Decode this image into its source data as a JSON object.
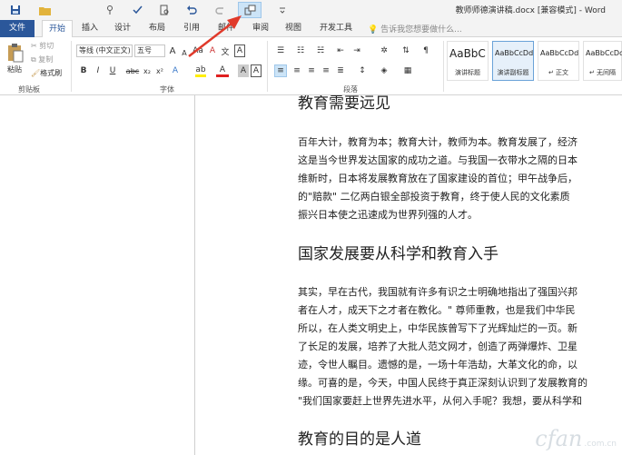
{
  "window_title": "教师师德演讲稿.docx [兼容模式] - Word",
  "quick_access": {
    "save_icon": "save-icon",
    "folder_icon": "folder-icon",
    "touch_icon": "touch-mode-icon",
    "spell_icon": "spellcheck-icon",
    "preview_icon": "print-preview-icon",
    "undo_icon": "undo-icon",
    "redo_icon": "redo-icon",
    "compare_icon": "compatibility-icon",
    "more_icon": "customize-icon"
  },
  "tabs": [
    {
      "label": "文件"
    },
    {
      "label": "开始"
    },
    {
      "label": "插入"
    },
    {
      "label": "设计"
    },
    {
      "label": "布局"
    },
    {
      "label": "引用"
    },
    {
      "label": "邮件"
    },
    {
      "label": "审阅"
    },
    {
      "label": "视图"
    },
    {
      "label": "开发工具"
    }
  ],
  "tell_me": "告诉我您想要做什么...",
  "clipboard": {
    "paste": "粘贴",
    "cut": "剪切",
    "copy": "复制",
    "format_painter": "格式刷",
    "group_label": "剪贴板"
  },
  "font": {
    "font_name": "等线 (中文正文)",
    "font_size": "五号",
    "grow": "A",
    "shrink": "A",
    "bold": "B",
    "italic": "I",
    "underline": "U",
    "strike": "abc",
    "subscript": "x₂",
    "superscript": "x²",
    "font_color": "A",
    "char_shading": "A",
    "char_border": "A",
    "group_label": "字体"
  },
  "paragraph": {
    "group_label": "段落"
  },
  "styles": [
    {
      "sample": "AaBbC",
      "name": "演讲标题"
    },
    {
      "sample": "AaBbCcDd",
      "name": "演讲副标题"
    },
    {
      "sample": "AaBbCcDd",
      "name": "↵ 正文"
    },
    {
      "sample": "AaBbCcDd",
      "name": "↵ 无间隔"
    }
  ],
  "document": {
    "sections": [
      {
        "heading": "教育需要远见",
        "lines": [
          "百年大计，教育为本；教育大计，教师为本。教育发展了，经济",
          "这是当今世界发达国家的成功之道。与我国一衣带水之隔的日本",
          "维新时，日本将发展教育放在了国家建设的首位；甲午战争后，",
          "的\"赔款\" 二亿两白银全部投资于教育，终于使人民的文化素质",
          "振兴日本使之迅速成为世界列强的人才。"
        ]
      },
      {
        "heading": "国家发展要从科学和教育入手",
        "lines": [
          "其实，早在古代，我国就有许多有识之士明确地指出了强国兴邦",
          "者在人才，成天下之才者在教化。\" 尊师重教，也是我们中华民",
          "所以，在人类文明史上，中华民族曾写下了光辉灿烂的一页。新",
          "了长足的发展，培养了大批人范文网才，创造了两弹爆炸、卫星",
          "迹，令世人瞩目。遗憾的是，一场十年浩劫，大革文化的命，以",
          "缘。可喜的是，今天，中国人民终于真正深刻认识到了发展教育的",
          "\"我们国家要赶上世界先进水平，从何入手呢？我想，要从科学和"
        ]
      },
      {
        "heading": "教育的目的是人道",
        "lines": []
      }
    ]
  },
  "watermark": {
    "text": "cfan",
    "suffix": ".com.cn"
  },
  "colors": {
    "accent": "#2b579a",
    "arrow": "#e03a2b"
  }
}
